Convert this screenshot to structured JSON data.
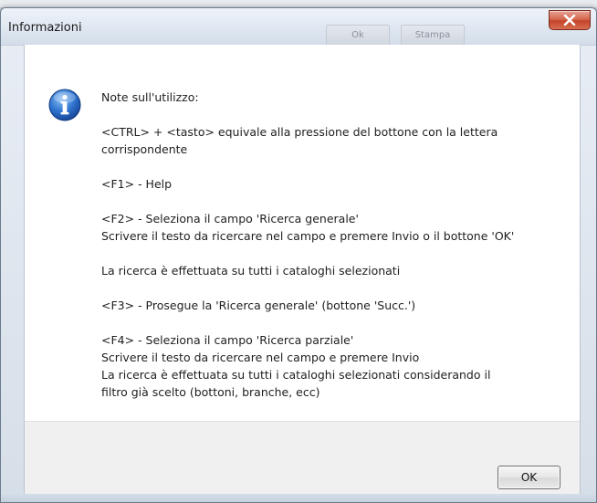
{
  "window": {
    "title": "Informazioni"
  },
  "background_app": {
    "button_1": "Ok",
    "button_2": "Stampa"
  },
  "message": {
    "icon": "info-icon",
    "text": "Note sull'utilizzo:\n\n<CTRL> + <tasto> equivale alla pressione del bottone con la lettera\ncorrispondente\n\n<F1> - Help\n\n<F2> - Seleziona il campo 'Ricerca generale'\nScrivere il testo da ricercare nel campo e premere Invio o il bottone 'OK'\n\nLa ricerca è effettuata su tutti i cataloghi selezionati\n\n<F3> - Prosegue la 'Ricerca generale' (bottone 'Succ.')\n\n<F4> - Seleziona il campo 'Ricerca parziale'\nScrivere il testo da ricercare nel campo e premere Invio\nLa ricerca è effettuata su tutti i cataloghi selezionati considerando il\nfiltro già scelto (bottoni, branche, ecc)"
  },
  "buttons": {
    "ok_label": "OK"
  },
  "colors": {
    "close_button": "#c4432a",
    "info_icon": "#2a6cc9"
  }
}
